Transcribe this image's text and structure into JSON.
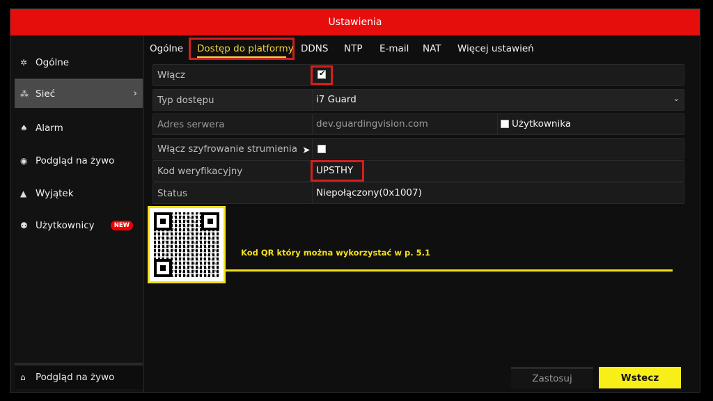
{
  "window": {
    "title": "Ustawienia"
  },
  "sidebar": {
    "items": [
      {
        "label": "Ogólne",
        "icon": "gear-icon"
      },
      {
        "label": "Sieć",
        "icon": "network-icon",
        "active": true
      },
      {
        "label": "Alarm",
        "icon": "bell-icon"
      },
      {
        "label": "Podgląd na żywo",
        "icon": "eye-icon"
      },
      {
        "label": "Wyjątek",
        "icon": "warning-icon"
      },
      {
        "label": "Użytkownicy",
        "icon": "users-icon",
        "badge": "NEW"
      }
    ],
    "bottom": {
      "label": "Podgląd na żywo",
      "icon": "home-icon"
    }
  },
  "tabs": [
    {
      "label": "Ogólne"
    },
    {
      "label": "Dostęp do platformy",
      "active": true
    },
    {
      "label": "DDNS"
    },
    {
      "label": "NTP"
    },
    {
      "label": "E-mail"
    },
    {
      "label": "NAT"
    },
    {
      "label": "Więcej ustawień"
    }
  ],
  "form": {
    "enable": {
      "label": "Włącz",
      "checked": true
    },
    "access_type": {
      "label": "Typ dostępu",
      "value": "i7 Guard"
    },
    "server": {
      "label": "Adres serwera",
      "value": "dev.guardingvision.com",
      "user_option": "Użytkownika",
      "user_checked": false
    },
    "encryption": {
      "label": "Włącz szyfrowanie strumienia",
      "checked": false
    },
    "verification": {
      "label": "Kod weryfikacyjny",
      "value": "UPSTHY"
    },
    "status": {
      "label": "Status",
      "value": "Niepołączony(0x1007)"
    }
  },
  "annotation": {
    "caption": "Kod QR który można wykorzystać w p. 5.1"
  },
  "buttons": {
    "apply": "Zastosuj",
    "back": "Wstecz"
  },
  "colors": {
    "title_bar": "#e60d0d",
    "accent_yellow": "#f4e21a",
    "highlight_red": "#d41e1e"
  }
}
